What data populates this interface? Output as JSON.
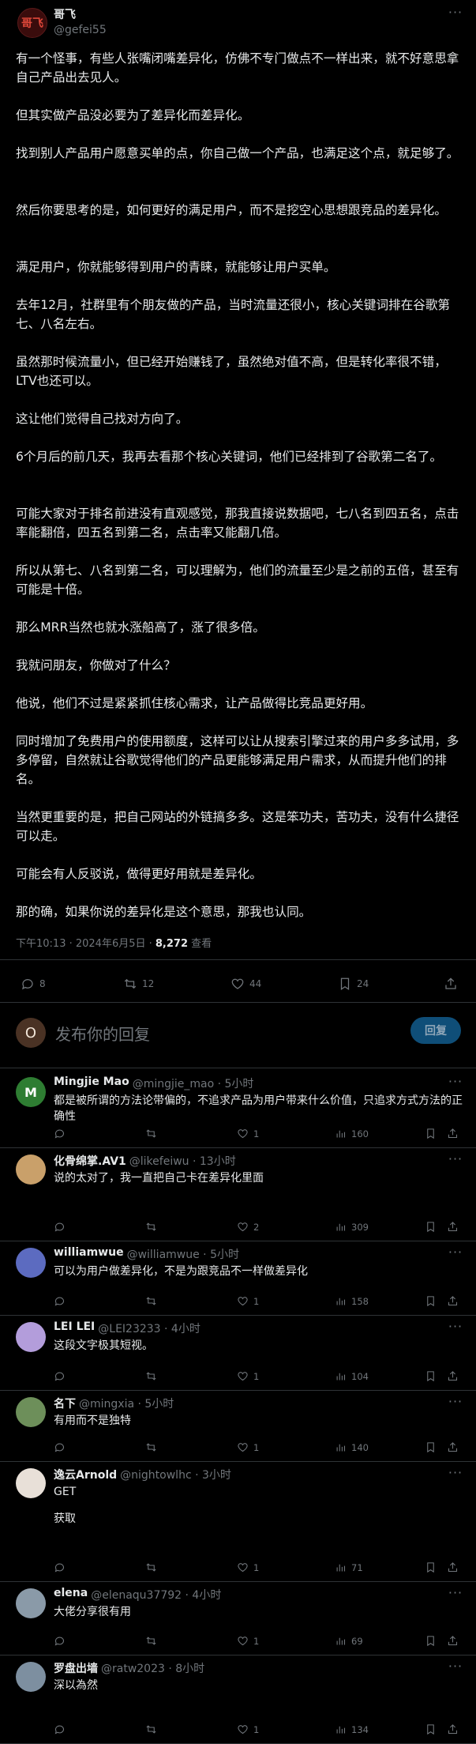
{
  "post": {
    "author_name": "哥飞",
    "author_handle": "@gefei55",
    "avatar_text": "哥飞",
    "paragraphs": [
      "有一个怪事，有些人张嘴闭嘴差异化，仿佛不专门做点不一样出来，就不好意思拿自己产品出去见人。",
      "但其实做产品没必要为了差异化而差异化。",
      "找到别人产品用户愿意买单的点，你自己做一个产品，也满足这个点，就足够了。",
      "然后你要思考的是，如何更好的满足用户，而不是挖空心思想跟竞品的差异化。",
      "满足用户，你就能够得到用户的青睐，就能够让用户买单。",
      "去年12月，社群里有个朋友做的产品，当时流量还很小，核心关键词排在谷歌第七、八名左右。",
      "虽然那时候流量小，但已经开始赚钱了，虽然绝对值不高，但是转化率很不错，LTV也还可以。",
      "这让他们觉得自己找对方向了。",
      "6个月后的前几天，我再去看那个核心关键词，他们已经排到了谷歌第二名了。",
      "可能大家对于排名前进没有直观感觉，那我直接说数据吧，七八名到四五名，点击率能翻倍，四五名到第二名，点击率又能翻几倍。",
      "所以从第七、八名到第二名，可以理解为，他们的流量至少是之前的五倍，甚至有可能是十倍。",
      "那么MRR当然也就水涨船高了，涨了很多倍。",
      "我就问朋友，你做对了什么？",
      "他说，他们不过是紧紧抓住核心需求，让产品做得比竞品更好用。",
      "同时增加了免费用户的使用额度，这样可以让从搜索引擎过来的用户多多试用，多多停留，自然就让谷歌觉得他们的产品更能够满足用户需求，从而提升他们的排名。",
      "当然更重要的是，把自己网站的外链搞多多。这是笨功夫，苦功夫，没有什么捷径可以走。",
      "可能会有人反驳说，做得更好用就是差异化。",
      "那的确，如果你说的差异化是这个意思，那我也认同。"
    ],
    "time": "下午10:13 · 2024年6月5日 · ",
    "views": "8,272",
    "views_label": " 查看",
    "stats": {
      "replies": "8",
      "reposts": "12",
      "likes": "44",
      "bookmarks": "24"
    }
  },
  "reply_box": {
    "avatar_letter": "O",
    "placeholder": "发布你的回复",
    "button": "回复"
  },
  "comments": [
    {
      "name": "Mingjie Mao",
      "handle": "@mingjie_mao · 5小时",
      "text": "都是被所谓的方法论带偏的，不追求产品为用户带来什么价值，只追求方式方法的正确性",
      "likes": "1",
      "views": "160",
      "avatar": "M",
      "avatar_color": "#2e7d32"
    },
    {
      "name": "化骨绵掌.AV1",
      "handle": "@likefeiwu · 13小时",
      "text": "说的太对了，我一直把自己卡在差异化里面",
      "likes": "2",
      "views": "309",
      "avatar": "",
      "avatar_color": "#c9a06a"
    },
    {
      "name": "williamwue",
      "handle": "@williamwue · 5小时",
      "text": "可以为用户做差异化，不是为跟竞品不一样做差异化",
      "likes": "1",
      "views": "158",
      "avatar": "",
      "avatar_color": "#5c6bc0"
    },
    {
      "name": "LEI LEI",
      "handle": "@LEI23233 · 4小时",
      "text": "这段文字极其短视。",
      "likes": "1",
      "views": "104",
      "avatar": "",
      "avatar_color": "#b39ddb"
    },
    {
      "name": "名下",
      "handle": "@mingxia · 5小时",
      "text": "有用而不是独特",
      "likes": "1",
      "views": "140",
      "avatar": "",
      "avatar_color": "#6d8f5a"
    },
    {
      "name": "逸云Arnold",
      "handle": "@nightowlhc · 3小时",
      "text": "GET",
      "text2": "获取",
      "likes": "1",
      "views": "71",
      "avatar": "",
      "avatar_color": "#e8e0d8"
    },
    {
      "name": "elena",
      "handle": "@elenaqu37792 · 4小时",
      "text": "大佬分享很有用",
      "likes": "1",
      "views": "69",
      "avatar": "",
      "avatar_color": "#8a9aa8"
    },
    {
      "name": "罗盘出墙",
      "handle": "@ratw2023 · 8小时",
      "text": "深以為然",
      "likes": "1",
      "views": "134",
      "avatar": "",
      "avatar_color": "#7d8fa0"
    }
  ]
}
